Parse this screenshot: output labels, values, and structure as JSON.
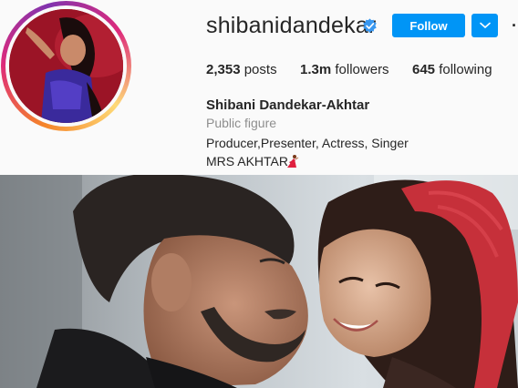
{
  "profile": {
    "username": "shibanidandekar",
    "verified": true,
    "follow_label": "Follow",
    "more_label": "·",
    "stats": {
      "posts_value": "2,353",
      "posts_label": "posts",
      "followers_value": "1.3m",
      "followers_label": "followers",
      "following_value": "645",
      "following_label": "following"
    },
    "full_name": "Shibani Dandekar-Akhtar",
    "category": "Public figure",
    "bio": {
      "line1": "Producer,Presenter, Actress, Singer",
      "line2": "MRS AKHTAR"
    },
    "emoji_icon": "dancer-emoji-icon"
  },
  "colors": {
    "accent": "#0095f6",
    "secondary_text": "#8e8e8e",
    "primary_text": "#262626",
    "verified": "#3897f0"
  }
}
